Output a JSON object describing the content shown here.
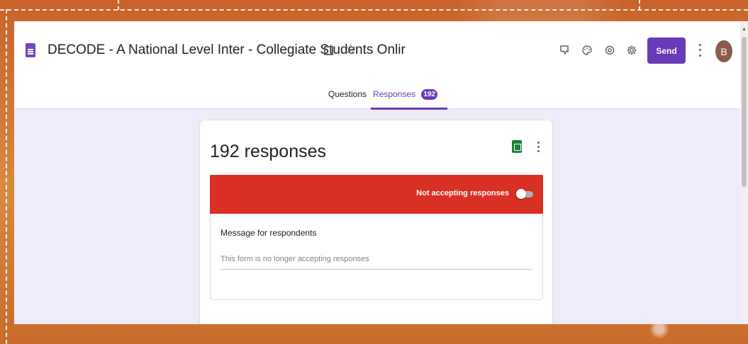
{
  "header": {
    "doc_title": "DECODE - A National Level Inter - Collegiate Students Onlir",
    "send_label": "Send",
    "avatar_initial": "B",
    "icons": [
      "customize-theme-icon",
      "palette-icon",
      "preview-icon",
      "settings-icon"
    ],
    "accent_color": "#673ab7"
  },
  "tabs": [
    {
      "label": "Questions",
      "active": false
    },
    {
      "label": "Responses",
      "active": true,
      "badge": "192"
    }
  ],
  "responses_card": {
    "title": "192 responses",
    "banner_label": "Not accepting responses",
    "banner_color": "#d93025",
    "accepting_responses": false,
    "message_label": "Message for respondents",
    "message_value": "This form is no longer accepting responses"
  }
}
